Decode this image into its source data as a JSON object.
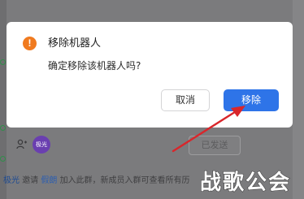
{
  "dialog": {
    "title": "移除机器人",
    "message": "确定移除该机器人吗?",
    "cancel_label": "取消",
    "confirm_label": "移除",
    "warning_icon": "!"
  },
  "background": {
    "avatar_text": "极光",
    "row_button_label": "已发送",
    "footer": {
      "name1": "极光",
      "text1": "邀请",
      "name2": "假朗",
      "text2": "加入此群，新成员入群可查看所有历"
    }
  },
  "watermark": {
    "text": "战歌公会"
  },
  "colors": {
    "primary": "#2e74e8",
    "warning": "#f07a1f",
    "annotation_arrow": "#d9262b"
  }
}
